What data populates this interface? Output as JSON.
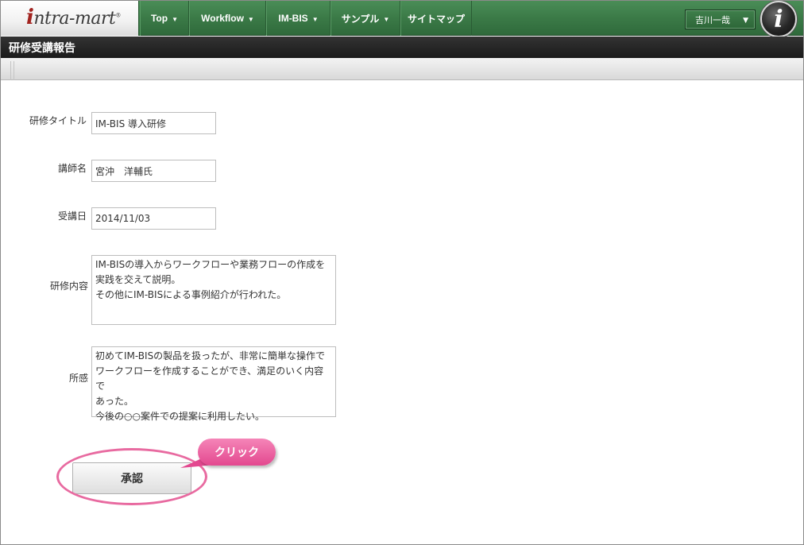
{
  "app": {
    "logo_prefix": "i",
    "logo_text": "ntra-mart",
    "logo_reg": "®"
  },
  "nav": {
    "items": [
      {
        "label": "Top",
        "has_menu": true
      },
      {
        "label": "Workflow",
        "has_menu": true
      },
      {
        "label": "IM-BIS",
        "has_menu": true
      },
      {
        "label": "サンプル",
        "has_menu": true
      },
      {
        "label": "サイトマップ",
        "has_menu": false
      }
    ],
    "user_name": "吉川一哉",
    "badge_letter": "i"
  },
  "page": {
    "title": "研修受講報告"
  },
  "form": {
    "title_label": "研修タイトル",
    "title_value": "IM-BIS 導入研修",
    "instructor_label": "講師名",
    "instructor_value": "宮沖　洋輔氏",
    "date_label": "受講日",
    "date_value": "2014/11/03",
    "content_label": "研修内容",
    "content_value": "IM-BISの導入からワークフローや業務フローの作成を\n実践を交えて説明。\nその他にIM-BISによる事例紹介が行われた。",
    "impression_label": "所感",
    "impression_value": "初めてIM-BISの製品を扱ったが、非常に簡単な操作で\nワークフローを作成することができ、満足のいく内容で\nあった。\n今後の○○案件での提案に利用したい。"
  },
  "actions": {
    "approve_label": "承認",
    "callout_label": "クリック"
  },
  "colors": {
    "nav_green": "#3b7a47",
    "title_bar": "#222222",
    "callout_pink": "#e8619f"
  }
}
